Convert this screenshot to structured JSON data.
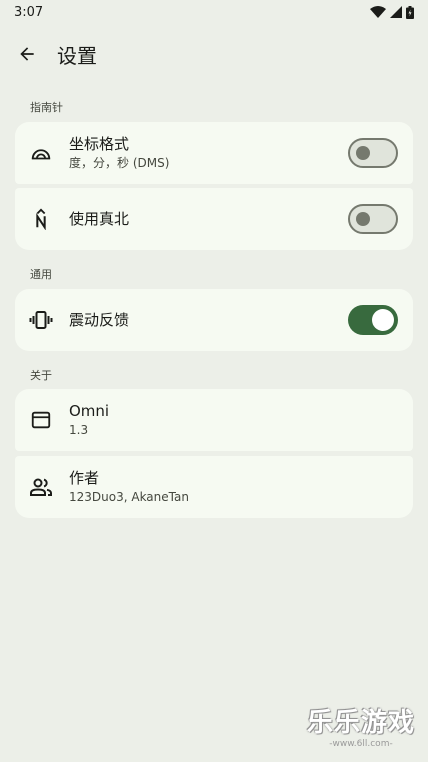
{
  "status_bar": {
    "time": "3:07"
  },
  "header": {
    "title": "设置"
  },
  "sections": {
    "compass": {
      "header": "指南针",
      "items": [
        {
          "title": "坐标格式",
          "subtitle": "度，分，秒 (DMS)",
          "icon": "angle-arc-icon",
          "switch_on": false
        },
        {
          "title": "使用真北",
          "icon": "true-north-icon",
          "switch_on": false
        }
      ]
    },
    "general": {
      "header": "通用",
      "items": [
        {
          "title": "震动反馈",
          "icon": "vibration-icon",
          "switch_on": true
        }
      ]
    },
    "about": {
      "header": "关于",
      "items": [
        {
          "title": "Omni",
          "subtitle": "1.3",
          "icon": "app-window-icon"
        },
        {
          "title": "作者",
          "subtitle": "123Duo3, AkaneTan",
          "icon": "people-icon"
        }
      ]
    }
  },
  "colors": {
    "background": "#ecefe8",
    "card": "#f6faf2",
    "accent": "#386a3e",
    "outline": "#75796e"
  },
  "watermark": {
    "main": "乐乐游戏",
    "sub": "-www.6ll.com-"
  }
}
